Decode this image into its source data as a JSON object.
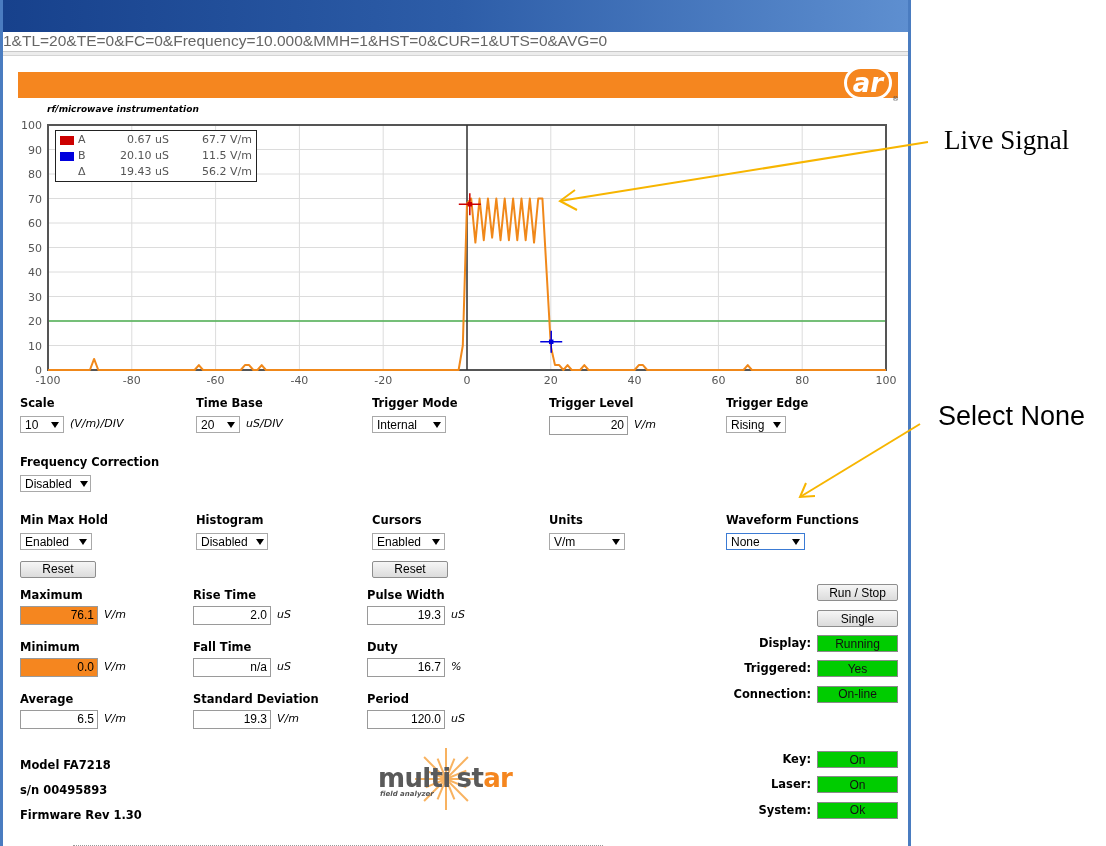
{
  "browser": {
    "address": "1&TL=20&TE=0&FC=0&Frequency=10.000&MMH=1&HST=0&CUR=1&UTS=0&AVG=0"
  },
  "banner": {
    "logo": "ar",
    "registered": "®",
    "tagline": "rf/microwave instrumentation"
  },
  "chart": {
    "readouts": [
      {
        "time": "0.67 uS",
        "value": "67.7 V/m"
      },
      {
        "time": "20.10 uS",
        "value": "11.5 V/m"
      },
      {
        "label": "Δ",
        "time": "19.43 uS",
        "value": "56.2 V/m"
      }
    ],
    "chart_data": {
      "type": "line",
      "x": [
        -100,
        -90,
        -89,
        -88,
        -65,
        -64,
        -63,
        -54,
        -53,
        -52,
        -51,
        -50,
        -49,
        -48,
        -2,
        -1,
        0,
        0.67,
        1,
        2,
        3,
        4,
        5,
        6,
        7,
        8,
        9,
        10,
        11,
        12,
        13,
        14,
        15,
        16,
        17,
        18,
        19,
        20,
        20.1,
        21,
        22,
        23,
        24,
        25,
        27,
        28,
        29,
        40,
        41,
        42,
        43,
        66,
        67,
        68,
        100
      ],
      "series": [
        {
          "color": "#f0881a",
          "values": [
            0,
            0,
            4.5,
            0,
            0,
            2,
            0,
            0,
            2,
            2,
            0,
            0,
            2,
            0,
            0,
            10,
            68,
            69.3,
            70,
            52,
            70,
            53,
            70,
            54,
            70,
            53,
            70,
            53,
            70,
            53,
            70,
            53,
            70,
            52,
            70,
            70,
            40,
            10,
            9,
            2,
            2,
            0,
            2,
            0,
            0,
            2,
            0,
            0,
            2,
            2,
            0,
            0,
            2,
            0,
            0
          ]
        },
        {
          "name": "A",
          "color": "#cc0000",
          "marker": "cross",
          "values": [
            null,
            null,
            null,
            null,
            null,
            null,
            null,
            null,
            null,
            null,
            null,
            null,
            null,
            null,
            null,
            null,
            null,
            67.7,
            null,
            null,
            null,
            null,
            null,
            null,
            null,
            null,
            null,
            null,
            null,
            null,
            null,
            null,
            null,
            null,
            null,
            null,
            null,
            null,
            null,
            null,
            null,
            null,
            null,
            null,
            null,
            null,
            null,
            null,
            null,
            null,
            null,
            null,
            null,
            null,
            null
          ]
        },
        {
          "name": "B",
          "color": "#0000dd",
          "marker": "cross",
          "values": [
            null,
            null,
            null,
            null,
            null,
            null,
            null,
            null,
            null,
            null,
            null,
            null,
            null,
            null,
            null,
            null,
            null,
            null,
            null,
            null,
            null,
            null,
            null,
            null,
            null,
            null,
            null,
            null,
            null,
            null,
            null,
            null,
            null,
            null,
            null,
            null,
            null,
            null,
            11.5,
            null,
            null,
            null,
            null,
            null,
            null,
            null,
            null,
            null,
            null,
            null,
            null,
            null,
            null,
            null,
            null
          ]
        }
      ],
      "xlim": [
        -100,
        100
      ],
      "ylim": [
        0,
        100
      ],
      "xticks": [
        -100,
        -80,
        -60,
        -40,
        -20,
        0,
        20,
        40,
        60,
        80,
        100
      ],
      "yticks": [
        0,
        10,
        20,
        30,
        40,
        50,
        60,
        70,
        80,
        90,
        100
      ],
      "grid": true,
      "legend": "upper left",
      "ref_lines": [
        {
          "axis": "y",
          "value": 20,
          "color": "#4caf50"
        },
        {
          "axis": "x",
          "value": 0,
          "color": "#333333"
        }
      ]
    }
  },
  "settings": [
    {
      "label": "Scale",
      "kind": "select",
      "value": "10",
      "unit": "(V/m)/DIV"
    },
    {
      "label": "Time Base",
      "kind": "select",
      "value": "20",
      "unit": "uS/DIV"
    },
    {
      "label": "Trigger Mode",
      "kind": "select",
      "value": "Internal"
    },
    {
      "label": "Trigger Level",
      "kind": "input",
      "value": "20",
      "unit": "V/m"
    },
    {
      "label": "Trigger Edge",
      "kind": "select",
      "value": "Rising"
    }
  ],
  "frequency_correction": {
    "label": "Frequency Correction",
    "value": "Disabled"
  },
  "options": [
    {
      "label": "Min Max Hold",
      "value": "Enabled",
      "focused": false,
      "button": "Reset"
    },
    {
      "label": "Histogram",
      "value": "Disabled",
      "focused": false
    },
    {
      "label": "Cursors",
      "value": "Enabled",
      "focused": false,
      "button": "Reset"
    },
    {
      "label": "Units",
      "value": "V/m",
      "focused": false
    },
    {
      "label": "Waveform Functions",
      "value": "None",
      "focused": true
    }
  ],
  "measurements": [
    {
      "label": "Maximum",
      "value": "76.1",
      "unit": "V/m",
      "highlighted": true
    },
    {
      "label": "Rise Time",
      "value": "2.0",
      "unit": "uS",
      "highlighted": false
    },
    {
      "label": "Pulse Width",
      "value": "19.3",
      "unit": "uS",
      "highlighted": false
    },
    {
      "label": "Minimum",
      "value": "0.0",
      "unit": "V/m",
      "highlighted": true
    },
    {
      "label": "Fall Time",
      "value": "n/a",
      "unit": "uS",
      "highlighted": false
    },
    {
      "label": "Duty",
      "value": "16.7",
      "unit": "%",
      "highlighted": false
    },
    {
      "label": "Average",
      "value": "6.5",
      "unit": "V/m",
      "highlighted": false
    },
    {
      "label": "Standard Deviation",
      "value": "19.3",
      "unit": "V/m",
      "highlighted": false
    },
    {
      "label": "Period",
      "value": "120.0",
      "unit": "uS",
      "highlighted": false
    }
  ],
  "buttons": [
    "Run / Stop",
    "Single"
  ],
  "status": [
    {
      "label": "Display:",
      "value": "Running"
    },
    {
      "label": "Triggered:",
      "value": "Yes"
    },
    {
      "label": "Connection:",
      "value": "On-line"
    }
  ],
  "device": [
    "Model FA7218",
    "s/n 00495893",
    "Firmware Rev 1.30"
  ],
  "product_logo": {
    "parts": [
      {
        "text": "multi",
        "accent": false
      },
      {
        "text": "st",
        "accent": false
      },
      {
        "text": "ar",
        "accent": true
      }
    ],
    "tagline": "field analyzer"
  },
  "indicators": [
    {
      "label": "Key:",
      "value": "On"
    },
    {
      "label": "Laser:",
      "value": "On"
    },
    {
      "label": "System:",
      "value": "Ok"
    }
  ],
  "callouts": [
    {
      "text": "Live Signal",
      "kind": "serif"
    },
    {
      "text": "Select None",
      "kind": "sans"
    }
  ]
}
